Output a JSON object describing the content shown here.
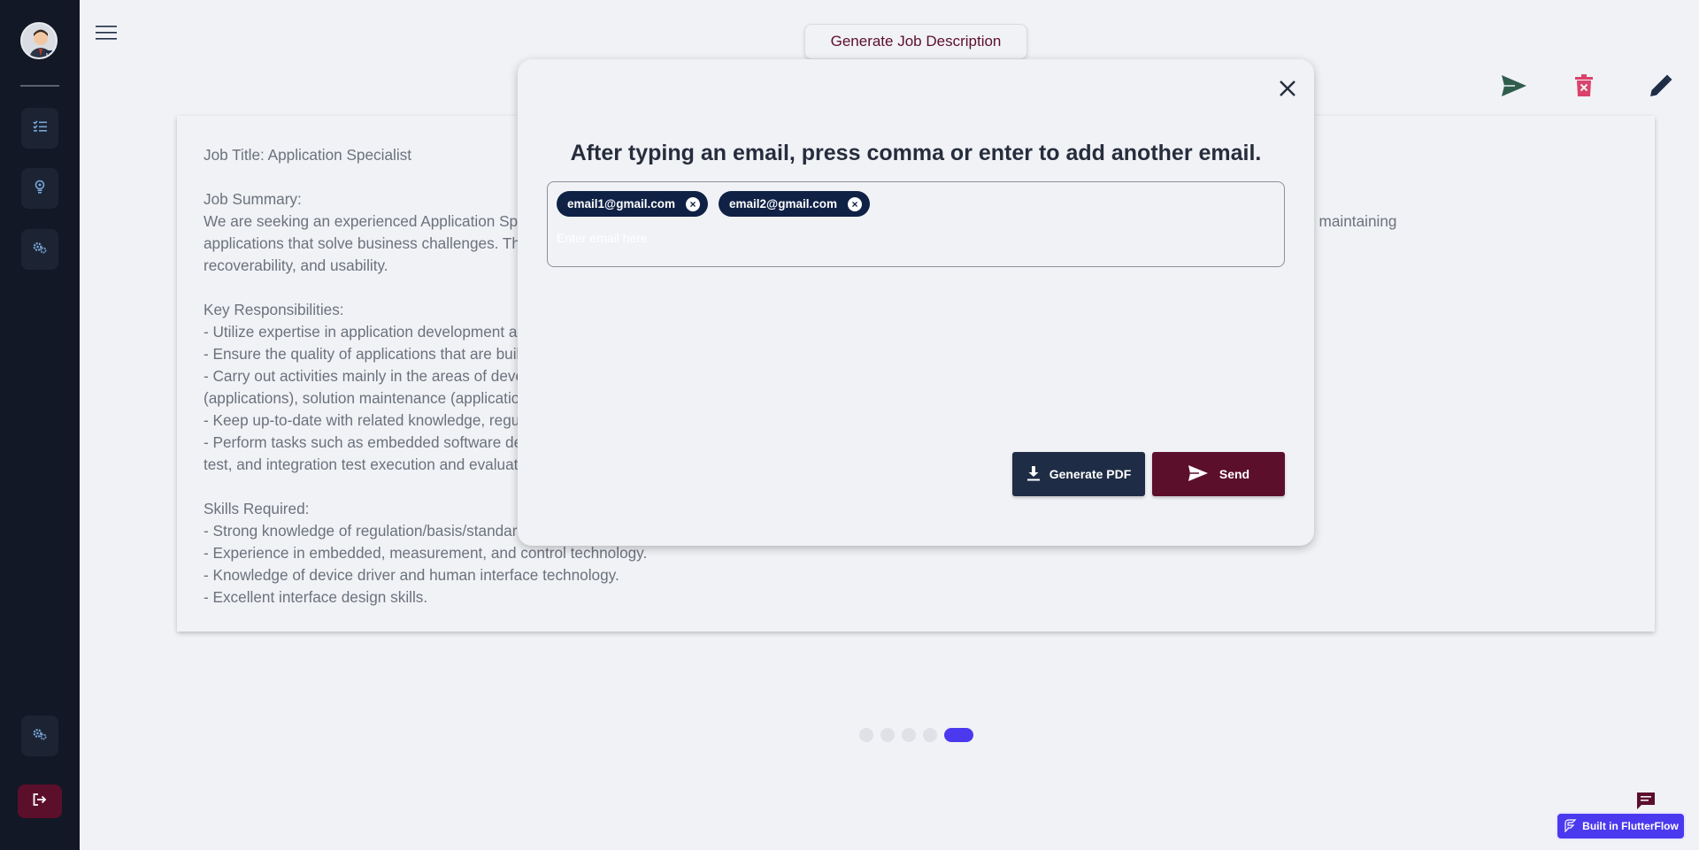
{
  "header": {
    "generate_jd_label": "Generate Job Description"
  },
  "job": {
    "text": "Job Title: Application Specialist\n\nJob Summary:\nWe are seeking an experienced Application Specialist to join our team. The successful candidate will be responsible for the design, developing, installing, testing, and maintaining\napplications that solve business challenges. The role also involves ensuring that the applications we build and deploy maintain high quality in terms of functionality,\nrecoverability, and usability.\n\nKey Responsibilities:\n- Utilize expertise in application development and related methods and tools to design, develop, install, test, and maintain applications.\n- Ensure the quality of applications that are built and deployed in terms of functionality, recoverability, and usability.\n- Carry out activities mainly in the areas of development (system and software requirements definition), solution deployment and maintenance (solution operation\n(applications), solution maintenance (applications)).\n- Keep up-to-date with related knowledge, regulations, and technologies, including embedded, measurement, control and human interface technology.\n- Perform tasks such as embedded software development, system requirements definition, system design, system qualification test, software integration\ntest, and integration test execution and evaluation.\n\nSkills Required:\n- Strong knowledge of regulation/basis/standards related to application development.\n- Experience in embedded, measurement, and control technology.\n- Knowledge of device driver and human interface technology.\n- Excellent interface design skills."
  },
  "modal": {
    "title": "After typing an email, press comma or enter to add another email.",
    "emails": [
      "email1@gmail.com",
      "email2@gmail.com"
    ],
    "remove_glyph": "×",
    "input_value": "",
    "input_placeholder": "Enter email here",
    "generate_pdf_label": "Generate PDF",
    "send_label": "Send"
  },
  "pager": {
    "count": 5,
    "active_index": 4
  },
  "badge": {
    "label": "Built in FlutterFlow"
  },
  "colors": {
    "sidebar_bg": "#121826",
    "accent": "#4b39ef",
    "maroon": "#5c0f2b",
    "navy": "#1e2d45",
    "send_icon": "#2f5d4c",
    "delete_icon": "#d9436b"
  },
  "icons": [
    "avatar",
    "menu-icon",
    "checklist-icon",
    "lightbulb-icon",
    "gears-icon",
    "logout-icon",
    "send-icon",
    "delete-icon",
    "edit-icon",
    "close-icon",
    "download-icon",
    "chat-icon",
    "flutterflow-icon"
  ]
}
